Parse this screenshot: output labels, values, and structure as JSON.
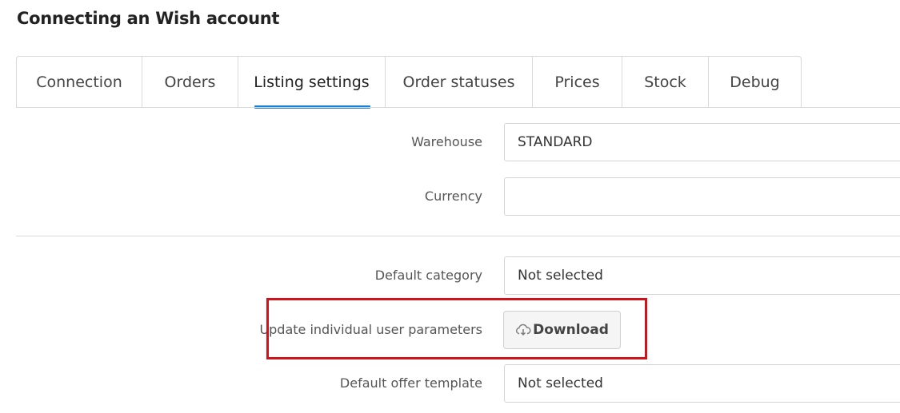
{
  "page": {
    "title": "Connecting an Wish account"
  },
  "tabs": [
    {
      "label": "Connection"
    },
    {
      "label": "Orders"
    },
    {
      "label": "Listing settings"
    },
    {
      "label": "Order statuses"
    },
    {
      "label": "Prices"
    },
    {
      "label": "Stock"
    },
    {
      "label": "Debug"
    }
  ],
  "active_tab": "Listing settings",
  "form": {
    "warehouse": {
      "label": "Warehouse",
      "value": "STANDARD"
    },
    "currency": {
      "label": "Currency",
      "value": ""
    },
    "default_category": {
      "label": "Default category",
      "value": "Not selected"
    },
    "update_params": {
      "label": "Update individual user parameters",
      "button_label": "Download",
      "icon": "cloud-download-icon"
    },
    "default_offer_template": {
      "label": "Default offer template",
      "value": "Not selected"
    }
  },
  "colors": {
    "accent": "#1d7fd3",
    "highlight": "#d0131a"
  }
}
